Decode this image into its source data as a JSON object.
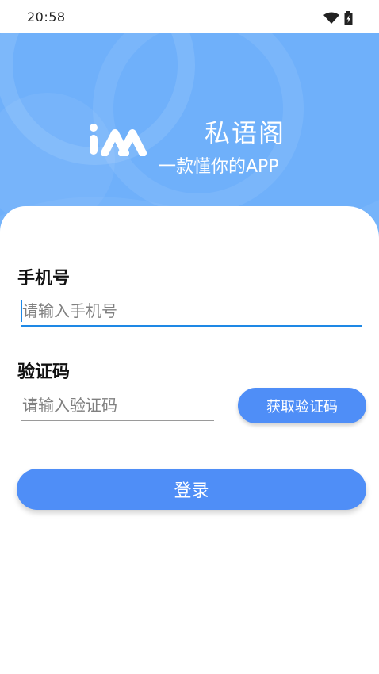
{
  "status_bar": {
    "time": "20:58",
    "icons": [
      "wifi-icon",
      "battery-icon"
    ]
  },
  "header": {
    "logo_text": "iAA",
    "app_name": "私语阁",
    "slogan": "一款懂你的APP"
  },
  "form": {
    "phone_label": "手机号",
    "phone_placeholder": "请输入手机号",
    "phone_value": "",
    "code_label": "验证码",
    "code_placeholder": "请输入验证码",
    "code_value": "",
    "get_code_button": "获取验证码",
    "login_button": "登录"
  },
  "colors": {
    "header_background": "#6fb0fa",
    "primary_button": "#4f8ef7",
    "focused_underline": "#1e88e5",
    "text_primary": "#111111",
    "placeholder": "#808080"
  }
}
